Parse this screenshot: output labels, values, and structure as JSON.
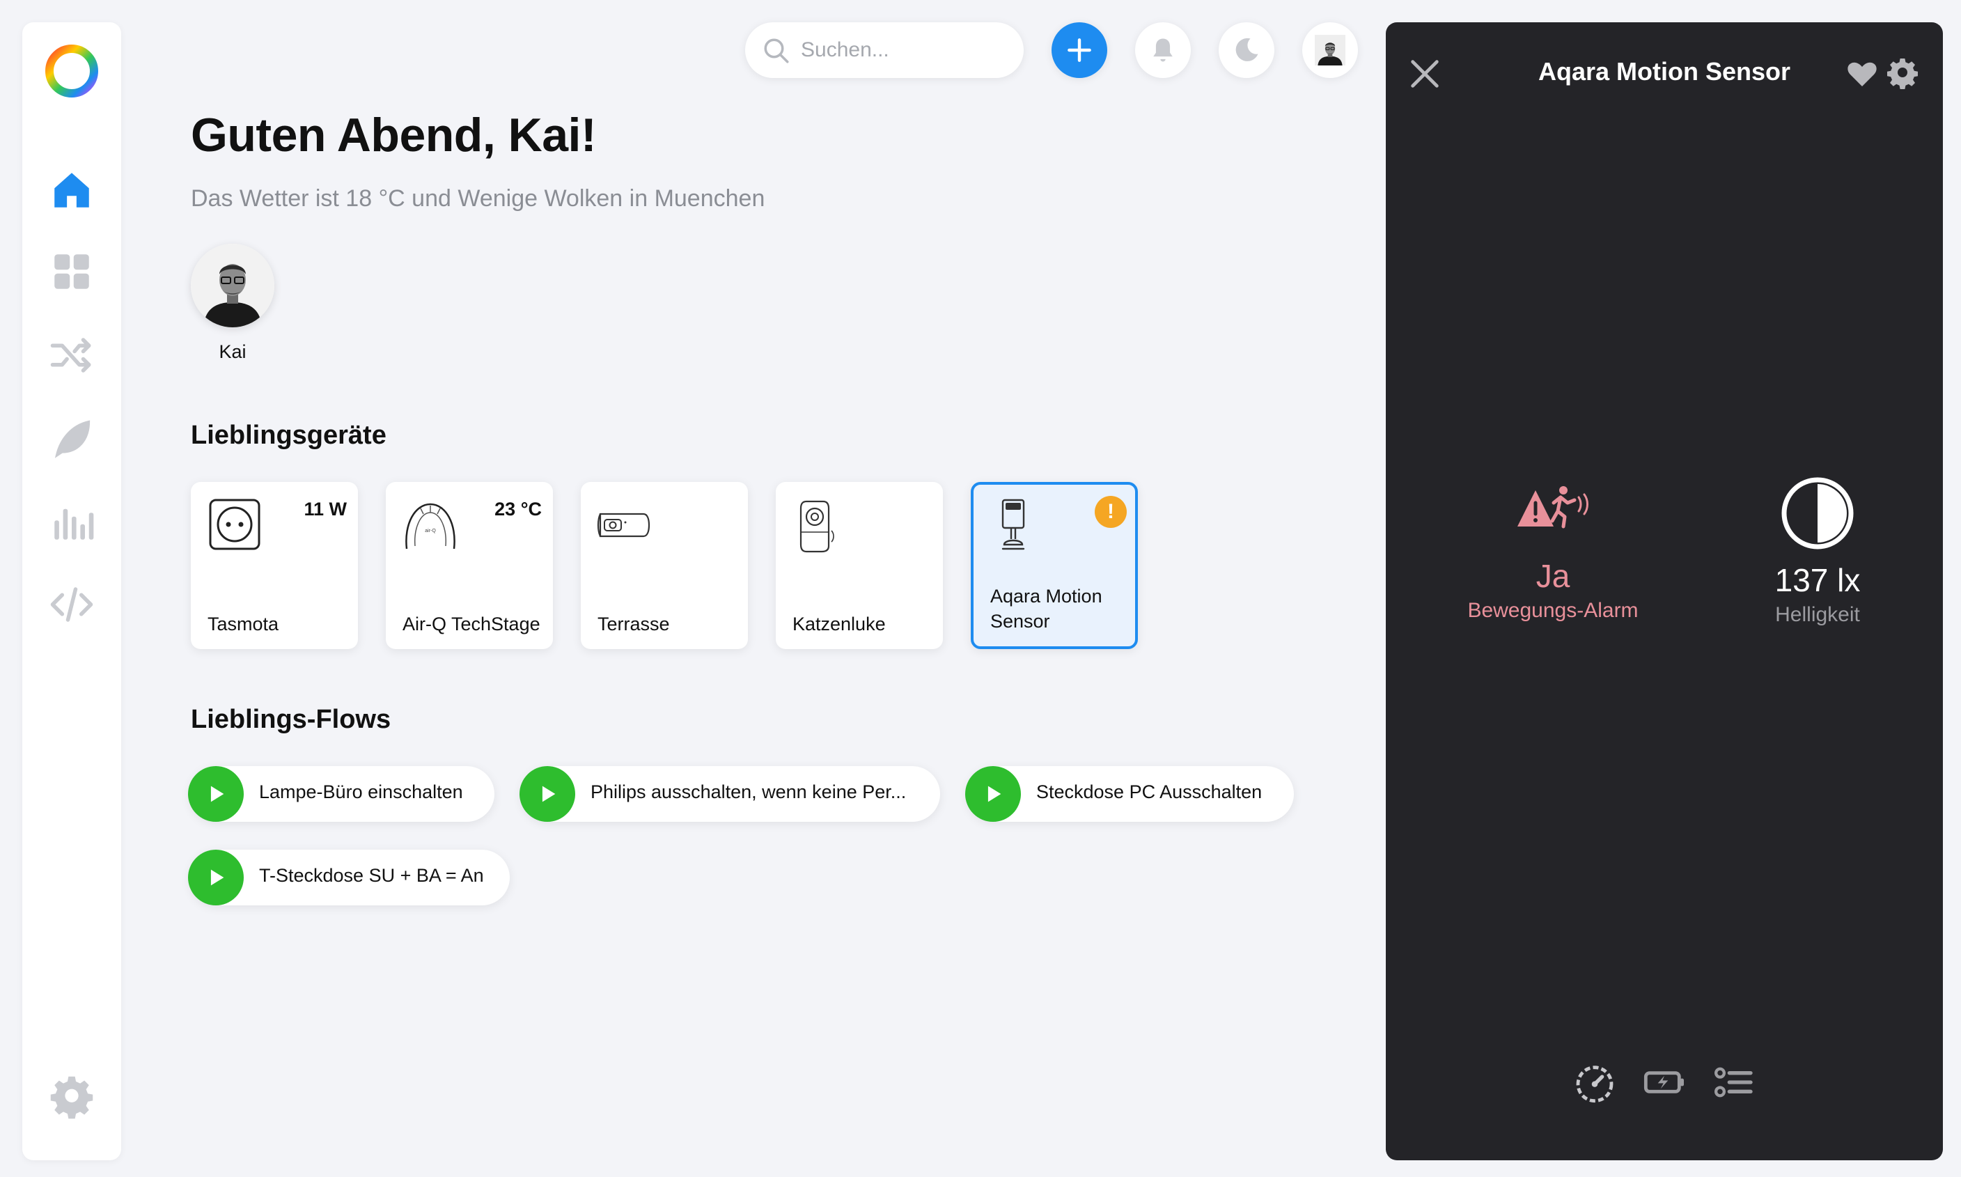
{
  "search": {
    "placeholder": "Suchen..."
  },
  "home": {
    "greeting": "Guten Abend, Kai!",
    "weather": "Das Wetter ist 18 °C und Wenige Wolken in Muenchen",
    "user_name": "Kai"
  },
  "favorites": {
    "title": "Lieblingsgeräte",
    "devices": [
      {
        "name": "Tasmota",
        "value": "11 W",
        "icon": "socket-icon"
      },
      {
        "name": "Air-Q TechStage",
        "value": "23 °C",
        "icon": "air-sensor-icon"
      },
      {
        "name": "Terrasse",
        "value": "",
        "icon": "camera-outdoor-icon"
      },
      {
        "name": "Katzenluke",
        "value": "",
        "icon": "camera-indoor-icon"
      },
      {
        "name": "Aqara Motion Sensor",
        "value": "",
        "icon": "motion-sensor-icon",
        "warning": "!"
      }
    ]
  },
  "flows": {
    "title": "Lieblings-Flows",
    "items": [
      {
        "label": "Lampe-Büro einschalten"
      },
      {
        "label": "Philips ausschalten, wenn keine Per..."
      },
      {
        "label": "Steckdose PC Ausschalten"
      },
      {
        "label": "T-Steckdose SU + BA = An"
      }
    ]
  },
  "panel": {
    "title": "Aqara Motion Sensor",
    "alarm": {
      "value": "Ja",
      "label": "Bewegungs-Alarm"
    },
    "luminance": {
      "value": "137 lx",
      "label": "Helligkeit"
    }
  },
  "colors": {
    "accent": "#1e8cf0",
    "flow_play": "#2ebd2e",
    "warning": "#f5a623",
    "alarm": "#e8909a",
    "panel_bg": "#242428"
  }
}
